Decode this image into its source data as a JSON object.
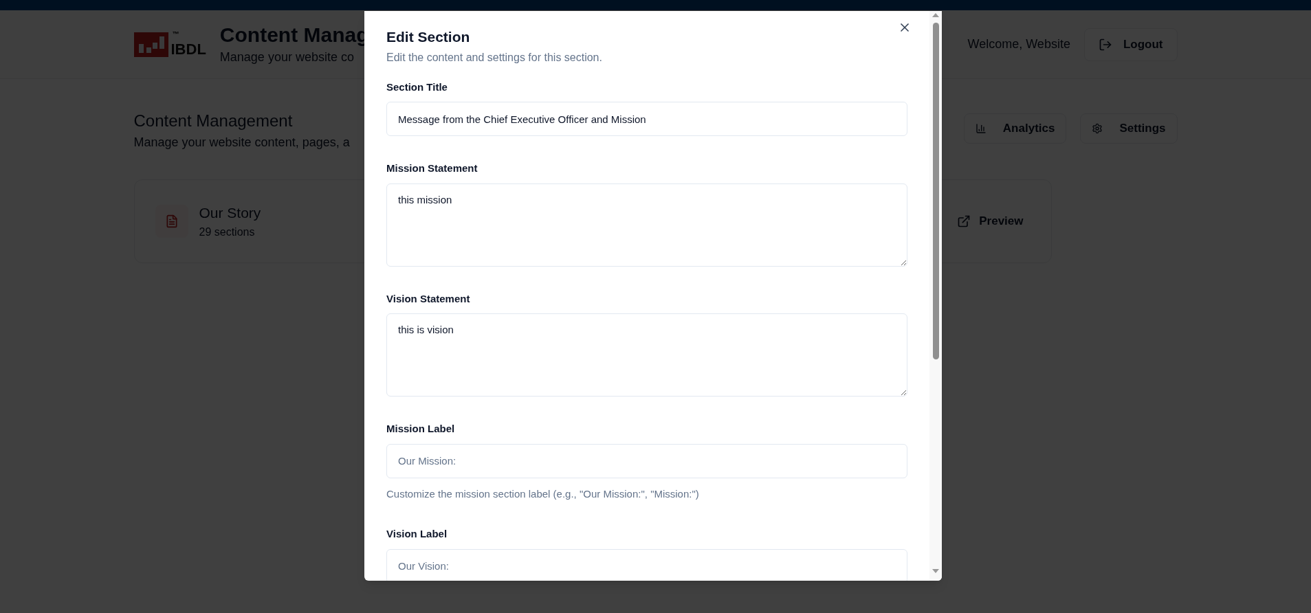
{
  "header": {
    "logo_text": "IBDL",
    "logo_mark": "™",
    "title": "Content Manag",
    "subtitle": "Manage your website co",
    "welcome": "Welcome, Website",
    "logout": "Logout"
  },
  "page": {
    "title": "Content Management",
    "subtitle": "Manage your website content, pages, a",
    "actions": [
      {
        "kind": "analytics",
        "label": "Analytics"
      },
      {
        "kind": "settings",
        "label": "Settings"
      }
    ]
  },
  "pages": [
    {
      "name": "Our Story",
      "count": "29 sections",
      "action": "Preview"
    }
  ],
  "dialog": {
    "title": "Edit Section",
    "description": "Edit the content and settings for this section.",
    "fields": [
      {
        "kind": "input",
        "label": "Section Title",
        "value": "Message from the Chief Executive Officer and Mission"
      },
      {
        "kind": "textarea",
        "label": "Mission Statement",
        "value": "this mission"
      },
      {
        "kind": "textarea",
        "label": "Vision Statement",
        "value": "this is vision"
      },
      {
        "kind": "input",
        "label": "Mission Label",
        "placeholder": "Our Mission:",
        "hint": "Customize the mission section label (e.g., \"Our Mission:\", \"Mission:\")"
      },
      {
        "kind": "input",
        "label": "Vision Label",
        "placeholder": "Our Vision:"
      }
    ]
  }
}
